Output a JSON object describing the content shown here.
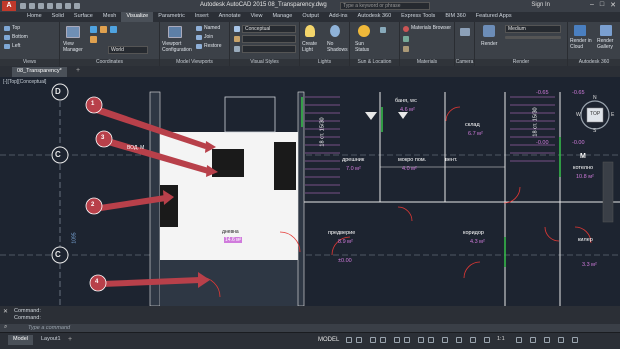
{
  "app": {
    "logo_text": "A",
    "title": "Autodesk AutoCAD 2015   08_Transparency.dwg",
    "search_placeholder": "Type a keyword or phrase",
    "signin": "Sign In"
  },
  "ribbon_tabs": [
    "Home",
    "Solid",
    "Surface",
    "Mesh",
    "Visualize",
    "Parametric",
    "Insert",
    "Annotate",
    "View",
    "Manage",
    "Output",
    "Add-ins",
    "Autodesk 360",
    "Express Tools",
    "BIM 360",
    "Featured Apps"
  ],
  "active_tab": "Visualize",
  "ribbon": {
    "views": {
      "title": "Views",
      "items": [
        "Top",
        "Bottom",
        "Left"
      ]
    },
    "coordinates": {
      "title": "Coordinates",
      "view_manager": "View\nManager",
      "ucs_combo": "World"
    },
    "model_viewports": {
      "title": "Model Viewports",
      "config": "Viewport\nConfiguration",
      "named": "Named",
      "join": "Join",
      "restore": "Restore"
    },
    "visual_styles": {
      "title": "Visual Styles",
      "combo": "Conceptual"
    },
    "lights": {
      "title": "Lights",
      "create_light": "Create\nLight",
      "no_shadows": "No\nShadows"
    },
    "sun_location": {
      "title": "Sun & Location",
      "sun_status": "Sun\nStatus"
    },
    "materials": {
      "title": "Materials",
      "browser": "Materials Browser"
    },
    "camera": {
      "title": "Camera"
    },
    "render": {
      "title": "Render",
      "render_btn": "Render",
      "preset": "Medium"
    },
    "autodesk360": {
      "title": "Autodesk 360",
      "render_cloud": "Render in\nCloud",
      "render_gallery": "Render\nGallery"
    }
  },
  "file_tab": "08_Transparency*",
  "viewport": {
    "label": "[-][Top][Conceptual]",
    "grid_letters": [
      "D",
      "C",
      "C"
    ],
    "callouts": [
      "1",
      "3",
      "2",
      "4"
    ],
    "rooms": [
      {
        "name": "дневна",
        "area": "14.6 м²"
      },
      {
        "name": "баня, wc",
        "area": "4.6 м²"
      },
      {
        "name": "склад",
        "area": "6.7 м²"
      },
      {
        "name": "дрешник",
        "area": "7.0 м²"
      },
      {
        "name": "мокро пом.",
        "area": "4.0 м²"
      },
      {
        "name": "вент.",
        "area": ""
      },
      {
        "name": "предверие",
        "area": "8.9 м²"
      },
      {
        "name": "коридор",
        "area": "4.3 м²"
      },
      {
        "name": "котелно",
        "area": "10.8 м²"
      },
      {
        "name": "килер",
        "area": "3.3 м²"
      }
    ],
    "labels": {
      "dim1": "1095",
      "level1": "-0.65",
      "level2": "±0.00",
      "level3": "-0.00",
      "stair1": "18 ст. 15/30",
      "stair2": "18 ст. 15/30",
      "compass_top": "TOP",
      "compass_n": "N",
      "compass_e": "E",
      "compass_s": "S",
      "compass_w": "W",
      "beam": "ВОД. М",
      "lvl_right": "-0.65",
      "lvl_right2": "-0.00",
      "m_label": "M"
    }
  },
  "command": {
    "line1": "Command:",
    "line2": "Command:",
    "placeholder": "Type a command"
  },
  "status": {
    "tabs": [
      "Model",
      "Layout1"
    ],
    "mode": "MODEL",
    "scale": "1:1"
  },
  "colors": {
    "walls": "#e8e8e8",
    "room_text": "#ffffff",
    "area_text": "#d07bdc",
    "door": "#e53935",
    "arrow": "#b8404a",
    "grid_axis": "#9ca6b2",
    "window_green": "#36c24a"
  }
}
